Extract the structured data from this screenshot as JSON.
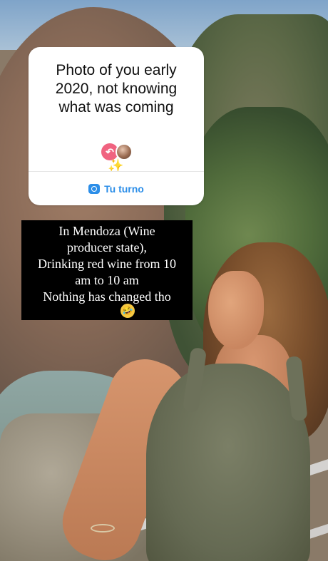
{
  "question_sticker": {
    "question": "Photo of you early\n2020, not knowing\nwhat was coming",
    "sparkle_glyph": "✨",
    "reply_glyph": "↶",
    "turn_label": "Tu turno",
    "accent_color": "#2c8ee8"
  },
  "answer": {
    "text": "In Mendoza (Wine\nproducer state),\nDrinking red wine from 10\nam to 10 am\nNothing has changed tho",
    "emoji_glyph": "😂"
  }
}
